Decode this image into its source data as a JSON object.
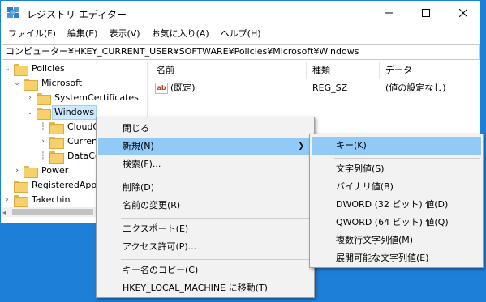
{
  "window": {
    "title": "レジストリ エディター",
    "controls": {
      "minimize": "minimize",
      "maximize": "maximize",
      "close": "close"
    }
  },
  "menubar": [
    "ファイル(F)",
    "編集(E)",
    "表示(V)",
    "お気に入り(A)",
    "ヘルプ(H)"
  ],
  "address": "コンピューター¥HKEY_CURRENT_USER¥SOFTWARE¥Policies¥Microsoft¥Windows",
  "tree": {
    "items": [
      {
        "label": "Policies"
      },
      {
        "label": "Microsoft"
      },
      {
        "label": "SystemCertificates"
      },
      {
        "label": "Windows"
      },
      {
        "label": "CloudC"
      },
      {
        "label": "Current"
      },
      {
        "label": "DataCo"
      },
      {
        "label": "Power"
      },
      {
        "label": "RegisteredApplic"
      },
      {
        "label": "Takechin"
      }
    ]
  },
  "list": {
    "columns": [
      "名前",
      "種類",
      "データ"
    ],
    "rows": [
      {
        "name": "(既定)",
        "type": "REG_SZ",
        "data": "(値の設定なし)"
      }
    ]
  },
  "context_menu": {
    "items": [
      "閉じる",
      "新規(N)",
      "検索(F)...",
      "削除(D)",
      "名前の変更(R)",
      "エクスポート(E)",
      "アクセス許可(P)...",
      "キー名のコピー(C)",
      "HKEY_LOCAL_MACHINE に移動(T)"
    ]
  },
  "submenu": {
    "items": [
      "キー(K)",
      "文字列値(S)",
      "バイナリ値(B)",
      "DWORD (32 ビット) 値(D)",
      "QWORD (64 ビット) 値(Q)",
      "複数行文字列値(M)",
      "展開可能な文字列値(E)"
    ]
  },
  "colors": {
    "desktop": "#1e7fd8",
    "highlight": "#91c9f7",
    "selection": "#cce8ff"
  }
}
